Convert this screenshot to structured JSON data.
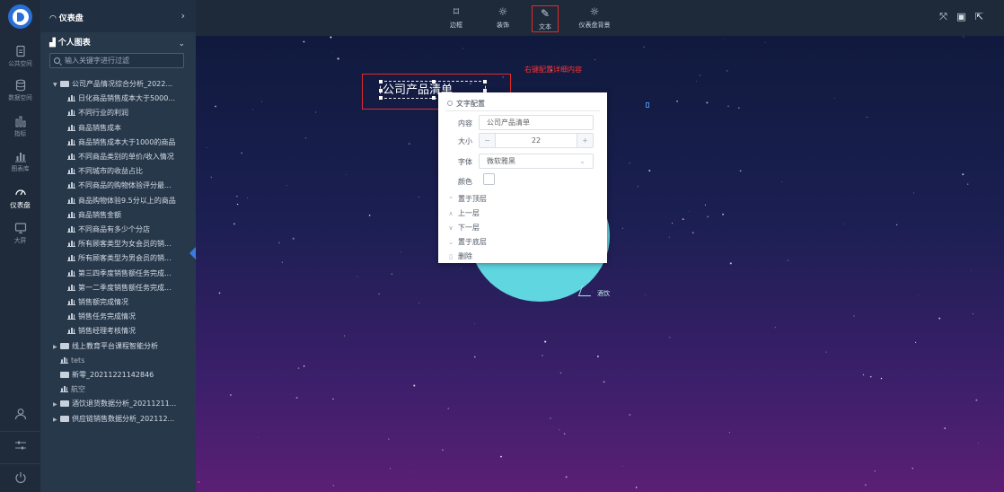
{
  "rail": {
    "items": [
      {
        "label": "公共空间",
        "icon": "file-icon"
      },
      {
        "label": "数据空间",
        "icon": "database-icon"
      },
      {
        "label": "指标",
        "icon": "bar-chart-icon"
      },
      {
        "label": "图表库",
        "icon": "chart-library-icon"
      },
      {
        "label": "仪表盘",
        "icon": "gauge-icon"
      },
      {
        "label": "大屏",
        "icon": "monitor-icon"
      }
    ],
    "bottom": [
      "user-icon",
      "settings-sliders-icon",
      "power-icon"
    ]
  },
  "panel": {
    "dashboard_header": "仪表盘",
    "section_title": "个人图表",
    "search_placeholder": "输入关键字进行过滤",
    "tree": [
      {
        "label": "公司产品情况综合分析_2022...",
        "type": "folder"
      },
      {
        "label": "日化商品销售成本大于5000...",
        "type": "chart"
      },
      {
        "label": "不同行业的利润",
        "type": "chart"
      },
      {
        "label": "商品销售成本",
        "type": "chart"
      },
      {
        "label": "商品销售成本大于1000的商品",
        "type": "chart"
      },
      {
        "label": "不同商品类别的单价/收入情况",
        "type": "chart"
      },
      {
        "label": "不同城市的收益占比",
        "type": "chart"
      },
      {
        "label": "不同商品的购物体验评分最...",
        "type": "chart"
      },
      {
        "label": "商品购物体验9.5分以上的商品",
        "type": "chart"
      },
      {
        "label": "商品销售金额",
        "type": "chart"
      },
      {
        "label": "不同商品有多少个分店",
        "type": "chart"
      },
      {
        "label": "所有顾客类型为女会员的销...",
        "type": "chart"
      },
      {
        "label": "所有顾客类型为男会员的销...",
        "type": "chart"
      },
      {
        "label": "第三四季度销售额任务完成...",
        "type": "chart"
      },
      {
        "label": "第一二季度销售额任务完成...",
        "type": "chart"
      },
      {
        "label": "销售额完成情况",
        "type": "chart"
      },
      {
        "label": "销售任务完成情况",
        "type": "chart"
      },
      {
        "label": "销售经理考核情况",
        "type": "chart"
      },
      {
        "label": "线上教育平台课程智能分析",
        "type": "folder"
      },
      {
        "label": "tets",
        "type": "chart-dim"
      },
      {
        "label": "新零_20211221142846",
        "type": "folder-flat"
      },
      {
        "label": "航空",
        "type": "chart-dim"
      },
      {
        "label": "酒饮退货数据分析_20211211...",
        "type": "folder"
      },
      {
        "label": "供应链销售数据分析_202112...",
        "type": "folder"
      }
    ]
  },
  "toolbar": {
    "tools": [
      {
        "label": "边框",
        "icon": "border-icon"
      },
      {
        "label": "装饰",
        "icon": "decoration-icon"
      },
      {
        "label": "文本",
        "icon": "text-edit-icon"
      },
      {
        "label": "仪表盘背景",
        "icon": "background-icon"
      }
    ],
    "right_icons": [
      "fullscreen-icon",
      "save-icon",
      "export-icon"
    ]
  },
  "canvas": {
    "hint": "右键配置详细内容",
    "text_content": "公司产品清单",
    "circle_label": "酒饮",
    "circle_color": "#5fd6e0"
  },
  "context_menu": {
    "title": "文字配置",
    "content_label": "内容",
    "content_value": "公司产品清单",
    "size_label": "大小",
    "size_value": "22",
    "font_label": "字体",
    "font_value": "微软雅黑",
    "color_label": "颜色",
    "actions": [
      "置于顶层",
      "上一层",
      "下一层",
      "置于底层",
      "删除"
    ]
  },
  "colors": {
    "accent": "#2a6fd6",
    "highlight": "#e02b2b"
  }
}
